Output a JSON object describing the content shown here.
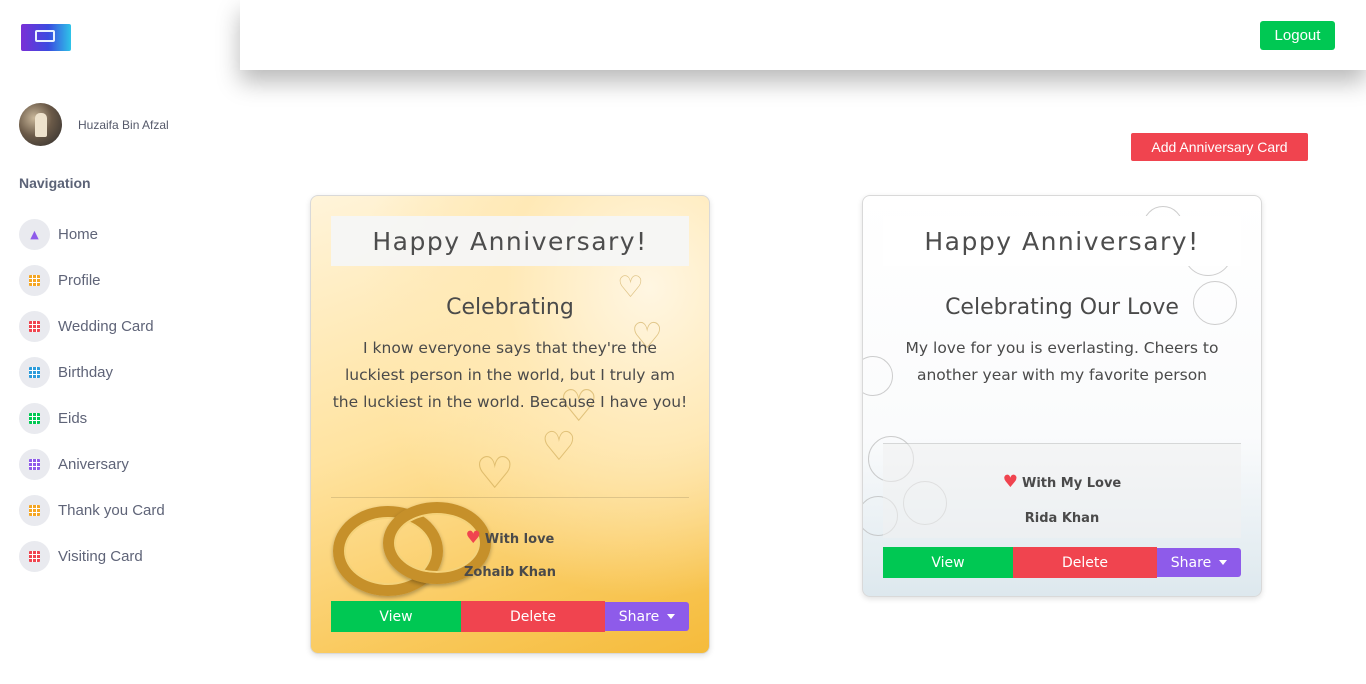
{
  "header": {
    "logout_label": "Logout"
  },
  "sidebar": {
    "user_name": "Huzaifa Bin Afzal",
    "nav_title": "Navigation",
    "items": [
      {
        "label": "Home",
        "icon": "home-icon",
        "color": "#8e5bea"
      },
      {
        "label": "Profile",
        "icon": "grid-icon",
        "color": "#f5a623"
      },
      {
        "label": "Wedding Card",
        "icon": "grid-icon",
        "color": "#f0444f"
      },
      {
        "label": "Birthday",
        "icon": "grid-icon",
        "color": "#2d9cdb"
      },
      {
        "label": "Eids",
        "icon": "grid-icon",
        "color": "#00c853"
      },
      {
        "label": "Aniversary",
        "icon": "grid-icon",
        "color": "#8e5bea"
      },
      {
        "label": "Thank you Card",
        "icon": "grid-icon",
        "color": "#f5a623"
      },
      {
        "label": "Visiting Card",
        "icon": "grid-icon",
        "color": "#f0444f"
      }
    ]
  },
  "main": {
    "add_button_label": "Add Anniversary Card",
    "cards": [
      {
        "title": "Happy Anniversary!",
        "subtitle": "Celebrating",
        "message": "I know everyone says that they're the luckiest person in the world, but I truly am the luckiest in the world. Because I have you!",
        "with_love": "With love",
        "signer": "Zohaib Khan",
        "view_label": "View",
        "delete_label": "Delete",
        "share_label": "Share"
      },
      {
        "title": "Happy Anniversary!",
        "subtitle": "Celebrating Our Love",
        "message": "My love for you is everlasting. Cheers to another year with my favorite person",
        "with_love": "With My Love",
        "signer": "Rida Khan",
        "view_label": "View",
        "delete_label": "Delete",
        "share_label": "Share"
      }
    ]
  },
  "colors": {
    "accent_green": "#00c853",
    "accent_red": "#f0444f",
    "accent_purple": "#8e5bea"
  }
}
